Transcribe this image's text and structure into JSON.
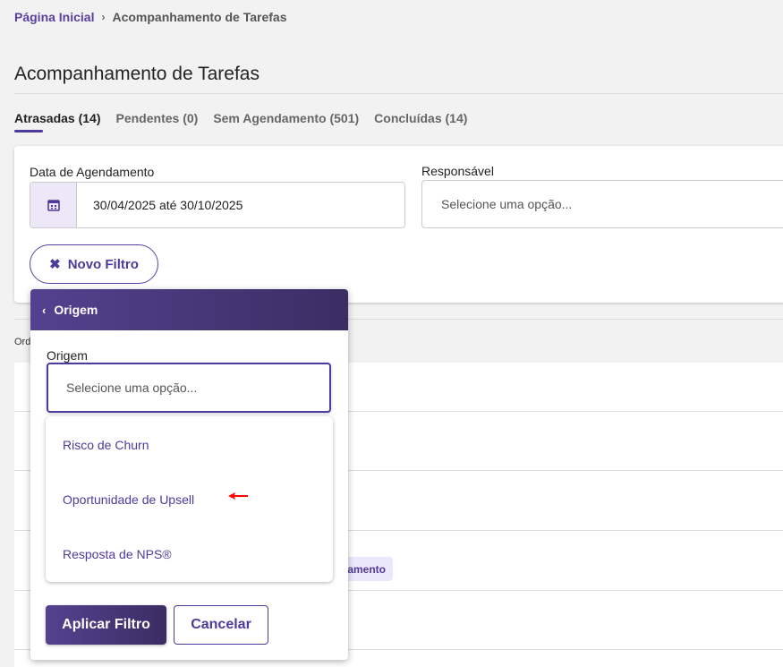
{
  "breadcrumb": {
    "home": "Página Inicial",
    "separator": "›",
    "current": "Acompanhamento de Tarefas"
  },
  "page_title": "Acompanhamento de Tarefas",
  "tabs": [
    {
      "label": "Atrasadas (14)",
      "active": true
    },
    {
      "label": "Pendentes (0)"
    },
    {
      "label": "Sem Agendamento (501)"
    },
    {
      "label": "Concluídas (14)"
    }
  ],
  "filters": {
    "date": {
      "label": "Data de Agendamento",
      "value": "30/04/2025 até 30/10/2025",
      "icon": "calendar-icon"
    },
    "responsible": {
      "label": "Responsável",
      "placeholder": "Selecione uma opção..."
    },
    "new_filter": {
      "label": "Novo Filtro",
      "icon": "close-icon"
    }
  },
  "background": {
    "order_label": "Ord",
    "chip": "amento"
  },
  "popover": {
    "title": "Origem",
    "back_icon": "chevron-left-icon",
    "field_label": "Origem",
    "placeholder": "Selecione uma opção...",
    "options": [
      "Risco de Churn",
      "Oportunidade de Upsell",
      "Resposta de NPS®"
    ],
    "apply": "Aplicar Filtro",
    "cancel": "Cancelar"
  },
  "colors": {
    "accent": "#4e3a9c",
    "header_gradient_start": "#54418f",
    "header_gradient_end": "#3b2d63",
    "annotation_arrow": "#ff0000"
  }
}
